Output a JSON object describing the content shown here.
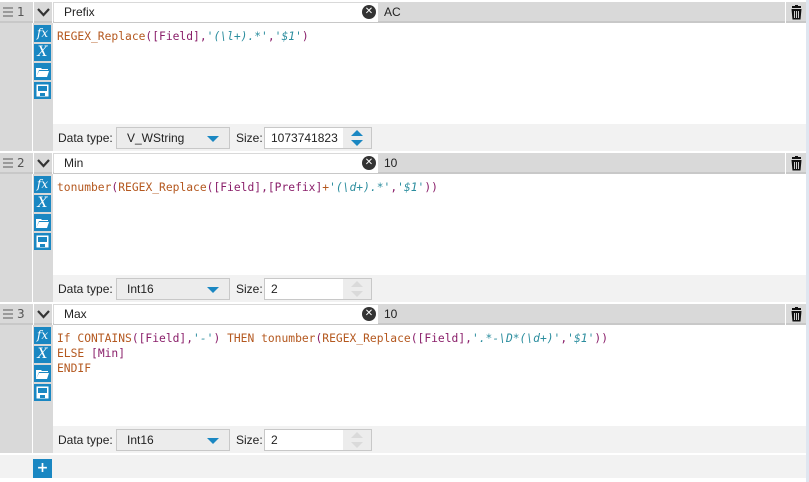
{
  "rows": [
    {
      "number": "1",
      "name": "Prefix",
      "value": "AC",
      "data_type_label": "Data type:",
      "data_type": "V_WString",
      "size_label": "Size:",
      "size": "1073741823",
      "size_enabled": true,
      "code": [
        [
          {
            "t": "REGEX_Replace",
            "c": "f"
          },
          {
            "t": "([Field],",
            "c": "p"
          },
          {
            "t": "'(\\l+).*'",
            "c": "s"
          },
          {
            "t": ",",
            "c": "p"
          },
          {
            "t": "'$1'",
            "c": "s"
          },
          {
            "t": ")",
            "c": "p"
          }
        ]
      ]
    },
    {
      "number": "2",
      "name": "Min",
      "value": "10",
      "data_type_label": "Data type:",
      "data_type": "Int16",
      "size_label": "Size:",
      "size": "2",
      "size_enabled": false,
      "code": [
        [
          {
            "t": "tonumber",
            "c": "f"
          },
          {
            "t": "(",
            "c": "p"
          },
          {
            "t": "REGEX_Replace",
            "c": "f"
          },
          {
            "t": "([Field],[Prefix]",
            "c": "p"
          },
          {
            "t": "+",
            "c": "f"
          },
          {
            "t": "'(\\d+).*'",
            "c": "s"
          },
          {
            "t": ",",
            "c": "p"
          },
          {
            "t": "'$1'",
            "c": "s"
          },
          {
            "t": "))",
            "c": "p"
          }
        ]
      ]
    },
    {
      "number": "3",
      "name": "Max",
      "value": "10",
      "data_type_label": "Data type:",
      "data_type": "Int16",
      "size_label": "Size:",
      "size": "2",
      "size_enabled": false,
      "code": [
        [
          {
            "t": "If CONTAINS",
            "c": "k"
          },
          {
            "t": "([Field],",
            "c": "p"
          },
          {
            "t": "'-'",
            "c": "s"
          },
          {
            "t": ") ",
            "c": "p"
          },
          {
            "t": "THEN tonumber",
            "c": "k"
          },
          {
            "t": "(",
            "c": "p"
          },
          {
            "t": "REGEX_Replace",
            "c": "f"
          },
          {
            "t": "([Field],",
            "c": "p"
          },
          {
            "t": "'.*-\\D*(\\d+)'",
            "c": "s"
          },
          {
            "t": ",",
            "c": "p"
          },
          {
            "t": "'$1'",
            "c": "s"
          },
          {
            "t": "))",
            "c": "p"
          }
        ],
        [
          {
            "t": "ELSE ",
            "c": "k"
          },
          {
            "t": "[Min]",
            "c": "p"
          }
        ],
        [
          {
            "t": "ENDIF",
            "c": "k"
          }
        ]
      ]
    }
  ],
  "icons": {
    "formula": "fx",
    "variable": "X"
  },
  "add_label": "+",
  "colors": {
    "accent": "#1a87c2"
  }
}
